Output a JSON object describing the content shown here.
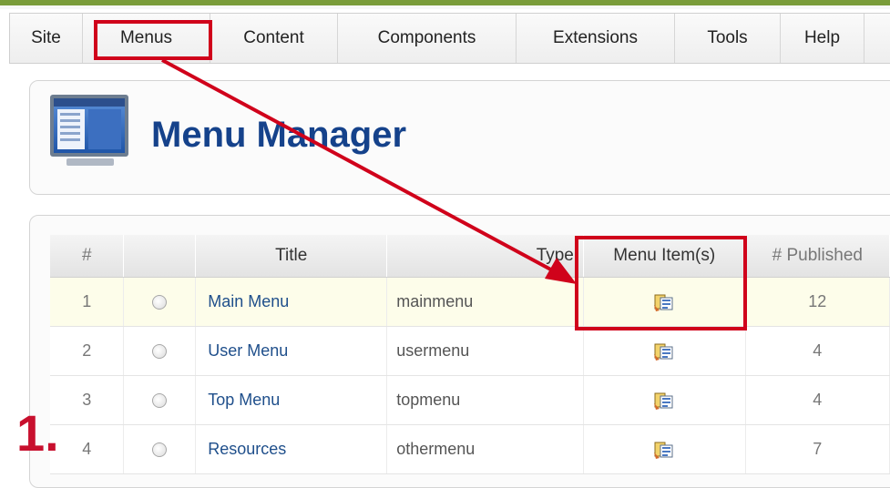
{
  "menubar": {
    "items": [
      {
        "label": "Site"
      },
      {
        "label": "Menus"
      },
      {
        "label": "Content"
      },
      {
        "label": "Components"
      },
      {
        "label": "Extensions"
      },
      {
        "label": "Tools"
      },
      {
        "label": "Help"
      }
    ]
  },
  "header": {
    "title": "Menu Manager",
    "icon": "menu-manager-icon"
  },
  "table": {
    "columns": [
      "#",
      "",
      "Title",
      "Type",
      "Menu Item(s)",
      "# Published"
    ],
    "rows": [
      {
        "num": "1",
        "title": "Main Menu",
        "type": "mainmenu",
        "published": "12"
      },
      {
        "num": "2",
        "title": "User Menu",
        "type": "usermenu",
        "published": "4"
      },
      {
        "num": "3",
        "title": "Top Menu",
        "type": "topmenu",
        "published": "4"
      },
      {
        "num": "4",
        "title": "Resources",
        "type": "othermenu",
        "published": "7"
      }
    ]
  },
  "annotation": {
    "step_label": "1.",
    "color": "#d0021b"
  },
  "colors": {
    "title": "#15428b",
    "link": "#1f4f8b",
    "highlight_row": "#fdfdea"
  }
}
